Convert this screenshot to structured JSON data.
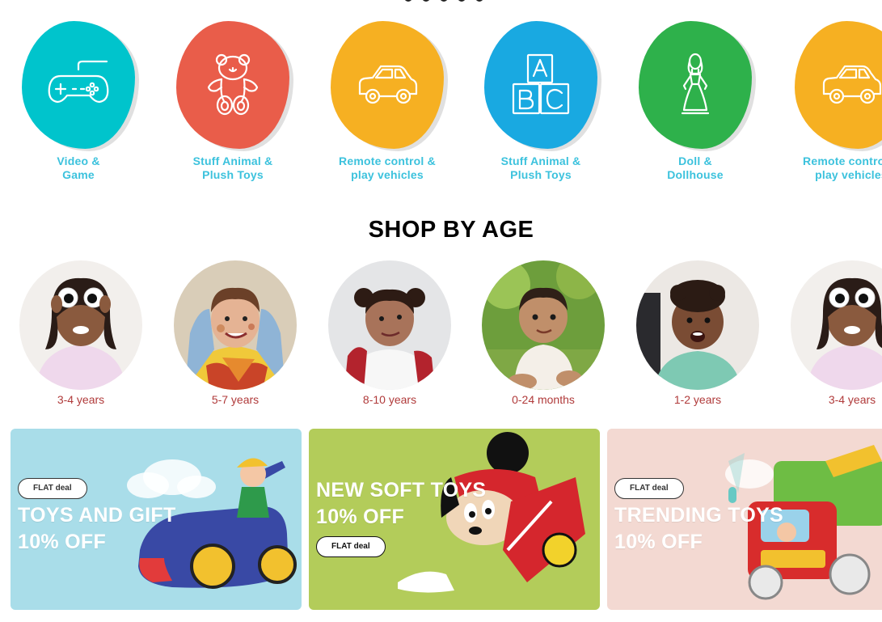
{
  "categories": [
    {
      "line1": "Video &",
      "line2": "Game",
      "color": "#00c4cc",
      "icon": "gamepad-icon"
    },
    {
      "line1": "Stuff Animal &",
      "line2": "Plush Toys",
      "color": "#e95d4a",
      "icon": "teddy-bear-icon"
    },
    {
      "line1": "Remote control &",
      "line2": "play vehicles",
      "color": "#f6b022",
      "icon": "car-icon"
    },
    {
      "line1": "Stuff Animal &",
      "line2": "Plush Toys",
      "color": "#19a9e1",
      "icon": "abc-blocks-icon"
    },
    {
      "line1": "Doll &",
      "line2": "Dollhouse",
      "color": "#2eb14b",
      "icon": "doll-icon"
    },
    {
      "line1": "Remote control &",
      "line2": "play vehicles",
      "color": "#f6b022",
      "icon": "car-icon"
    }
  ],
  "shop_by_age": {
    "title": "SHOP BY AGE",
    "items": [
      {
        "label": "3-4 years"
      },
      {
        "label": "5-7 years"
      },
      {
        "label": "8-10 years"
      },
      {
        "label": "0-24 months"
      },
      {
        "label": "1-2 years"
      },
      {
        "label": "3-4 years"
      }
    ]
  },
  "banners": [
    {
      "pill": "FLAT deal",
      "line1": "TOYS AND GIFT",
      "line2": "10% OFF",
      "bg": "#a9dde9"
    },
    {
      "line1": "NEW SOFT TOYS",
      "line2": "10% OFF",
      "pill": "FLAT deal",
      "bg": "#b3cc5a"
    },
    {
      "pill": "FLAT deal",
      "line1": "TRENDING TOYS",
      "line2": "10% OFF",
      "bg": "#f3d9d2"
    }
  ]
}
